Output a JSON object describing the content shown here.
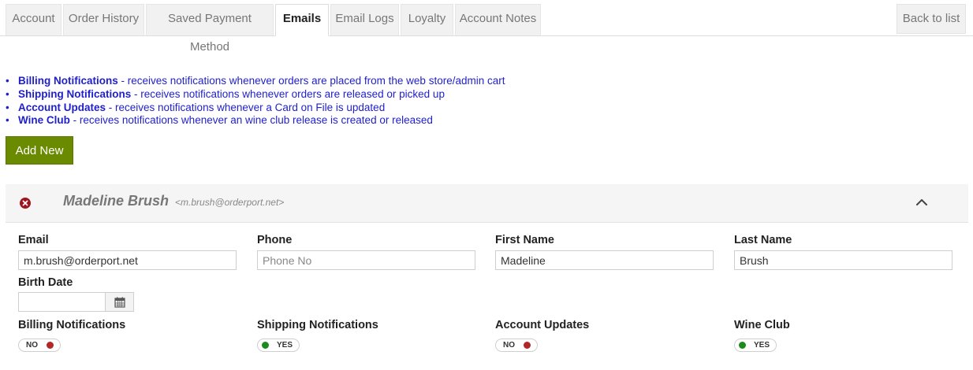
{
  "tabs": [
    {
      "label": "Account",
      "active": false
    },
    {
      "label": "Order History",
      "active": false
    },
    {
      "label": "Saved Payment Method",
      "active": false
    },
    {
      "label": "Emails",
      "active": true
    },
    {
      "label": "Email Logs",
      "active": false
    },
    {
      "label": "Loyalty",
      "active": false
    },
    {
      "label": "Account Notes",
      "active": false
    }
  ],
  "back_button": "Back to list",
  "legend": [
    {
      "term": "Billing Notifications",
      "desc": " - receives notifications whenever orders are placed from the web store/admin cart"
    },
    {
      "term": "Shipping Notifications",
      "desc": " - receives notifications whenever orders are released or picked up"
    },
    {
      "term": "Account Updates",
      "desc": " - receives notifications whenever a Card on File is updated"
    },
    {
      "term": "Wine Club",
      "desc": " - receives notifications whenever an wine club release is created or released"
    }
  ],
  "add_new_button": "Add New",
  "contact": {
    "name": "Madeline Brush",
    "email_display": "<m.brush@orderport.net>",
    "fields": {
      "email": {
        "label": "Email",
        "value": "m.brush@orderport.net",
        "placeholder": ""
      },
      "phone": {
        "label": "Phone",
        "value": "",
        "placeholder": "Phone No"
      },
      "first_name": {
        "label": "First Name",
        "value": "Madeline",
        "placeholder": ""
      },
      "last_name": {
        "label": "Last Name",
        "value": "Brush",
        "placeholder": ""
      },
      "birth_date": {
        "label": "Birth Date",
        "value": "",
        "placeholder": ""
      }
    },
    "notifications": {
      "billing": {
        "label": "Billing Notifications",
        "state": "NO"
      },
      "shipping": {
        "label": "Shipping Notifications",
        "state": "YES"
      },
      "account": {
        "label": "Account Updates",
        "state": "NO"
      },
      "wine_club": {
        "label": "Wine Club",
        "state": "YES"
      }
    }
  },
  "colors": {
    "accent_green": "#6a8a00",
    "legend_blue": "#1f1fcc",
    "toggle_on": "#1c8a1c",
    "toggle_off": "#b02828",
    "delete_icon": "#a0141e"
  },
  "icons": {
    "delete": "circle-x-icon",
    "collapse": "chevron-up-icon",
    "calendar": "calendar-icon",
    "bullet": "bullet-dot"
  }
}
